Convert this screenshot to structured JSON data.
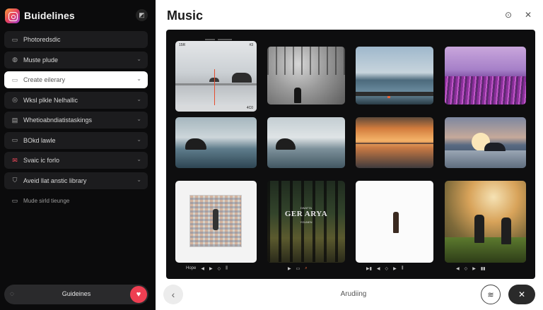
{
  "sidebar": {
    "app_title": "Buidelines",
    "header_icon": "camera-off-icon",
    "items": [
      {
        "label": "Photoredsdic",
        "icon": "folder-icon"
      },
      {
        "label": "Muste plude",
        "icon": "globe-icon"
      },
      {
        "label": "Create eilerary",
        "icon": "folder-icon"
      },
      {
        "label": "Wksl plkle Nelhallic",
        "icon": "target-icon"
      },
      {
        "label": "Whetioabndiatistaskings",
        "icon": "layers-icon"
      },
      {
        "label": "BOkd lawle",
        "icon": "folder-icon"
      },
      {
        "label": "Svaic ic forlo",
        "icon": "mail-icon"
      },
      {
        "label": "Aveid llat anstic library",
        "icon": "shield-icon"
      },
      {
        "label": "Mude sirld tieunge",
        "icon": "folder-icon"
      }
    ],
    "footer": {
      "label": "Guideines",
      "left_icon": "chat-icon",
      "right_icon": "heart-icon"
    }
  },
  "main": {
    "title": "Music",
    "top_icons": [
      "settings-circle-icon",
      "close-icon"
    ],
    "tiles": {
      "t1_top_left": "15R",
      "t1_top_right": "#3",
      "t1_bottom_right": "4C0",
      "t10_small_top": "DWATTA",
      "t10_title": "GER ARYA",
      "t10_small_bottom": "YOUNEN",
      "t9_caption": "Hope"
    }
  },
  "bottom_bar": {
    "label": "Arudiing",
    "back_icon": "chevron-left-icon",
    "cast_icon": "wifi-icon",
    "close_icon": "close-icon"
  },
  "colors": {
    "sidebar_bg": "#0b0b0c",
    "viewer_bg": "#0e0e0f",
    "accent_heart": "#ee3f52",
    "accent_orange": "#e9643a"
  }
}
